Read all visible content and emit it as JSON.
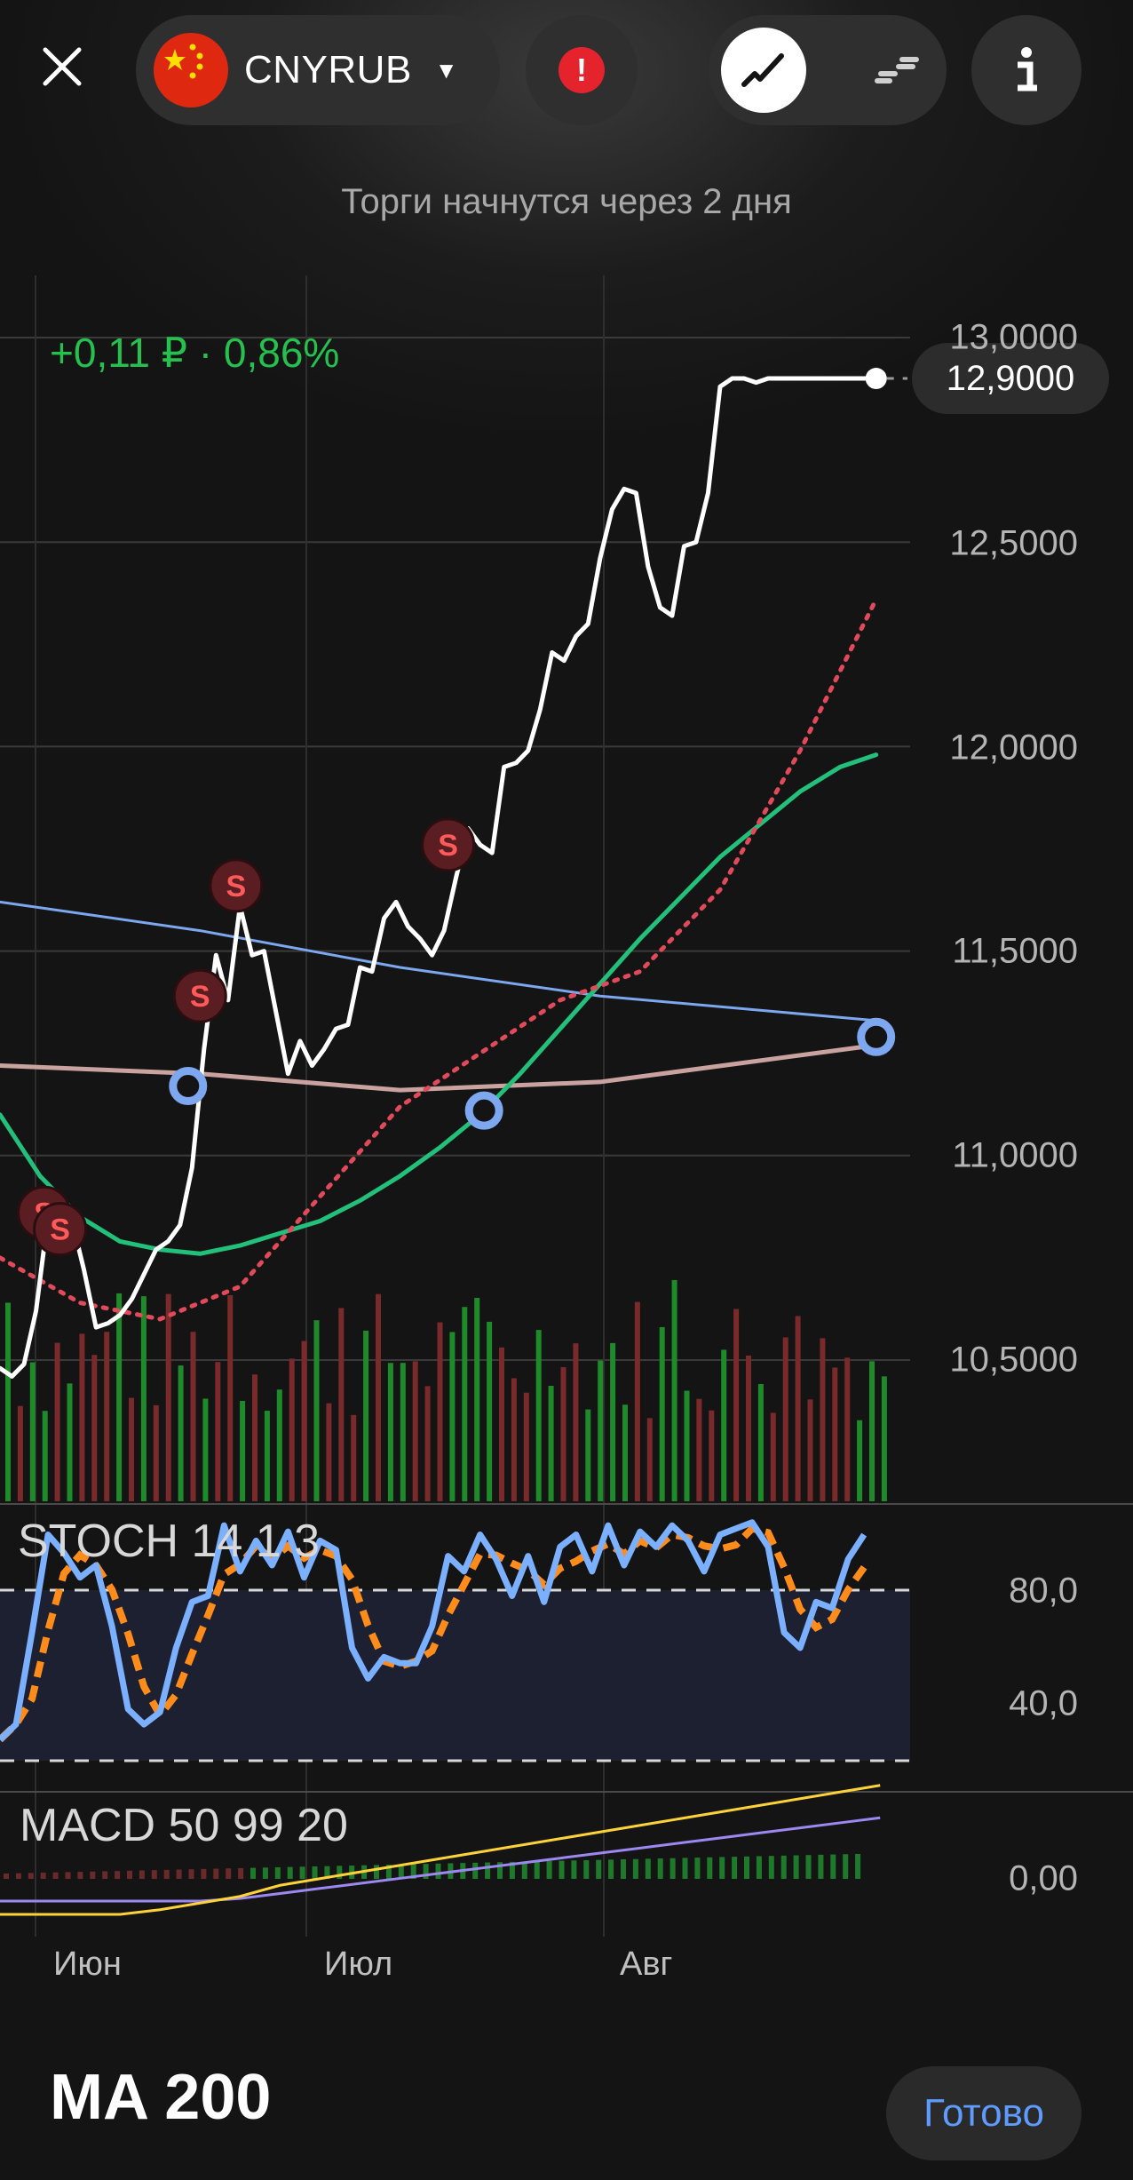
{
  "header": {
    "ticker": "CNYRUB",
    "status": "Торги начнутся через 2 дня",
    "change_text": "+0,11 ₽ · 0,86%",
    "current_price": "12,9000"
  },
  "colors": {
    "price": "#ffffff",
    "ma_red": "#e04a5a",
    "ma_green": "#22c07a",
    "ma_blue": "#7da7ee",
    "ma_pink": "#caa3a0",
    "vol_up": "#1e8a2a",
    "vol_down": "#7a2a2a",
    "stoch_k": "#7ab0ff",
    "stoch_d": "#ff8c1a",
    "macd_line": "#ffd23a",
    "macd_signal": "#9b88f0",
    "accent": "#25c04e",
    "done": "#5e9bff"
  },
  "icons": [
    "close-icon",
    "china-flag-icon",
    "chevron-down-icon",
    "alert-icon",
    "line-chart-icon",
    "candle-chart-icon",
    "info-icon",
    "sell-signal-icon"
  ],
  "panels": {
    "stoch_label": "STOCH 14 1 3",
    "macd_label": "MACD 50 99 20"
  },
  "footer": {
    "title": "MA 200",
    "done_label": "Готово"
  },
  "chart_data": {
    "type": "line",
    "x_ticks": [
      "Июн",
      "Июл",
      "Авг"
    ],
    "price_axis": {
      "ylim": [
        10.15,
        13.1
      ],
      "tick_labels": [
        "13,0000",
        "12,5000",
        "12,0000",
        "11,5000",
        "11,0000",
        "10,5000"
      ],
      "tick_values": [
        13.0,
        12.5,
        12.0,
        11.5,
        11.0,
        10.5
      ]
    },
    "series": [
      {
        "x": [
          0,
          0.3,
          0.6,
          0.9,
          1.2,
          1.5,
          1.8,
          2.1,
          2.4,
          2.7,
          3.0,
          3.3,
          3.6,
          3.9,
          4.2,
          4.5,
          4.8,
          5.1,
          5.4,
          5.7,
          6.0,
          6.3,
          6.6,
          6.9,
          7.2,
          7.5,
          7.8,
          8.1,
          8.4,
          8.7,
          9.0,
          9.3,
          9.6,
          9.9,
          10.2,
          10.5,
          10.8,
          11.1,
          11.4,
          11.7,
          12.0,
          12.3,
          12.6,
          12.9,
          13.2,
          13.5,
          13.8,
          14.1,
          14.4,
          14.7,
          15.0,
          15.3,
          15.6,
          15.9,
          16.2,
          16.5,
          16.8,
          17.1,
          17.4,
          17.7,
          18.0,
          18.3,
          18.6,
          18.9,
          19.2,
          19.5,
          19.8,
          20.1,
          20.4,
          20.7,
          21.0,
          21.3,
          21.6,
          21.9
        ],
        "values": [
          10.48,
          10.46,
          10.49,
          10.62,
          10.85,
          10.88,
          10.84,
          10.72,
          10.58,
          10.59,
          10.61,
          10.65,
          10.71,
          10.77,
          10.79,
          10.83,
          10.97,
          11.26,
          11.49,
          11.38,
          11.61,
          11.49,
          11.5,
          11.35,
          11.2,
          11.28,
          11.22,
          11.26,
          11.31,
          11.32,
          11.46,
          11.45,
          11.58,
          11.62,
          11.56,
          11.53,
          11.49,
          11.55,
          11.68,
          11.8,
          11.76,
          11.74,
          11.95,
          11.96,
          11.99,
          12.09,
          12.23,
          12.21,
          12.27,
          12.3,
          12.46,
          12.58,
          12.63,
          12.62,
          12.44,
          12.34,
          12.32,
          12.49,
          12.5,
          12.62,
          12.88,
          12.9,
          12.9,
          12.89,
          12.9,
          12.9,
          12.9,
          12.9,
          12.9,
          12.9,
          12.9,
          12.9,
          12.9,
          12.9
        ]
      },
      {
        "x": [
          0,
          2,
          4,
          6,
          8,
          10,
          12,
          14,
          16,
          18,
          20,
          21.9
        ],
        "values": [
          10.75,
          10.64,
          10.6,
          10.68,
          10.9,
          11.12,
          11.25,
          11.38,
          11.45,
          11.65,
          11.99,
          12.36
        ]
      },
      {
        "x": [
          0,
          1,
          2,
          3,
          4,
          5,
          6,
          7,
          8,
          9,
          10,
          11,
          12,
          13,
          14,
          15,
          16,
          17,
          18,
          19,
          20,
          21,
          21.9
        ],
        "values": [
          11.1,
          10.95,
          10.85,
          10.79,
          10.77,
          10.76,
          10.78,
          10.81,
          10.84,
          10.89,
          10.95,
          11.02,
          11.1,
          11.2,
          11.31,
          11.42,
          11.53,
          11.63,
          11.73,
          11.81,
          11.89,
          11.95,
          11.98
        ]
      },
      {
        "x": [
          0,
          5,
          10,
          15,
          21.9
        ],
        "values": [
          11.62,
          11.55,
          11.46,
          11.39,
          11.33
        ]
      },
      {
        "x": [
          0,
          5,
          10,
          15,
          21.9
        ],
        "values": [
          11.22,
          11.2,
          11.16,
          11.18,
          11.27
        ]
      }
    ],
    "stoch_axis": {
      "ylim": [
        10,
        100
      ],
      "tick_labels": [
        "80,0",
        "40,0"
      ],
      "tick_values": [
        80,
        40
      ],
      "band": [
        20,
        80
      ]
    },
    "macd_axis": {
      "tick_labels": [
        "0,00"
      ],
      "tick_values": [
        0
      ]
    },
    "sell_signals": [
      {
        "x": 1.1,
        "y": 10.86
      },
      {
        "x": 1.5,
        "y": 10.82
      },
      {
        "x": 5.0,
        "y": 11.39
      },
      {
        "x": 5.9,
        "y": 11.66
      },
      {
        "x": 11.2,
        "y": 11.76
      }
    ],
    "markers": [
      {
        "x": 4.7,
        "y": 11.17
      },
      {
        "x": 12.1,
        "y": 11.11
      },
      {
        "x": 21.9,
        "y": 11.29
      }
    ]
  }
}
